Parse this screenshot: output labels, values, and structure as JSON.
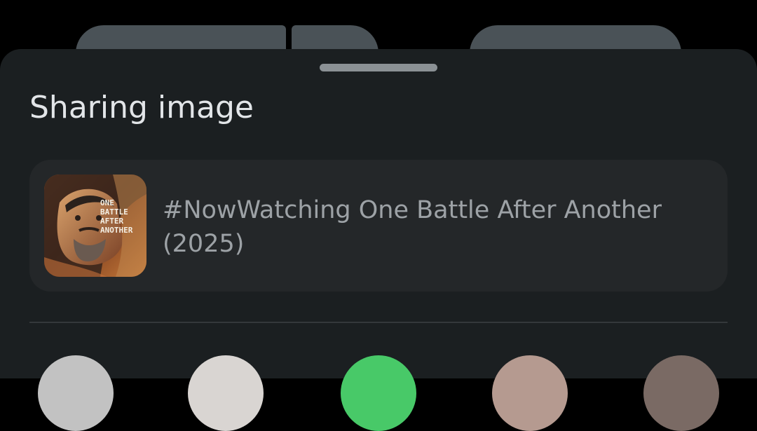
{
  "background_app": {
    "buttons": [
      {
        "icon": "action-icon"
      },
      {
        "icon": "dropdown-icon"
      },
      {
        "icon": "action-icon"
      }
    ]
  },
  "share_sheet": {
    "title": "Sharing image",
    "preview": {
      "text": "#NowWatching One Battle After Another (2025)",
      "thumbnail_text": [
        "ONE",
        "BATTLE",
        "AFTER",
        "ANOTHER"
      ]
    },
    "app_targets": [
      {
        "name": "share-target-1",
        "color": "#c2c2c2"
      },
      {
        "name": "share-target-2",
        "color": "#d9d5d2"
      },
      {
        "name": "share-target-3",
        "color": "#48c968"
      },
      {
        "name": "share-target-4",
        "color": "#b59a90"
      },
      {
        "name": "share-target-5",
        "color": "#7a6a64"
      }
    ]
  },
  "colors": {
    "sheet_bg": "#1b1f21",
    "card_bg": "#242729",
    "title": "#e2e5e8",
    "secondary_text": "#9da2a6"
  }
}
